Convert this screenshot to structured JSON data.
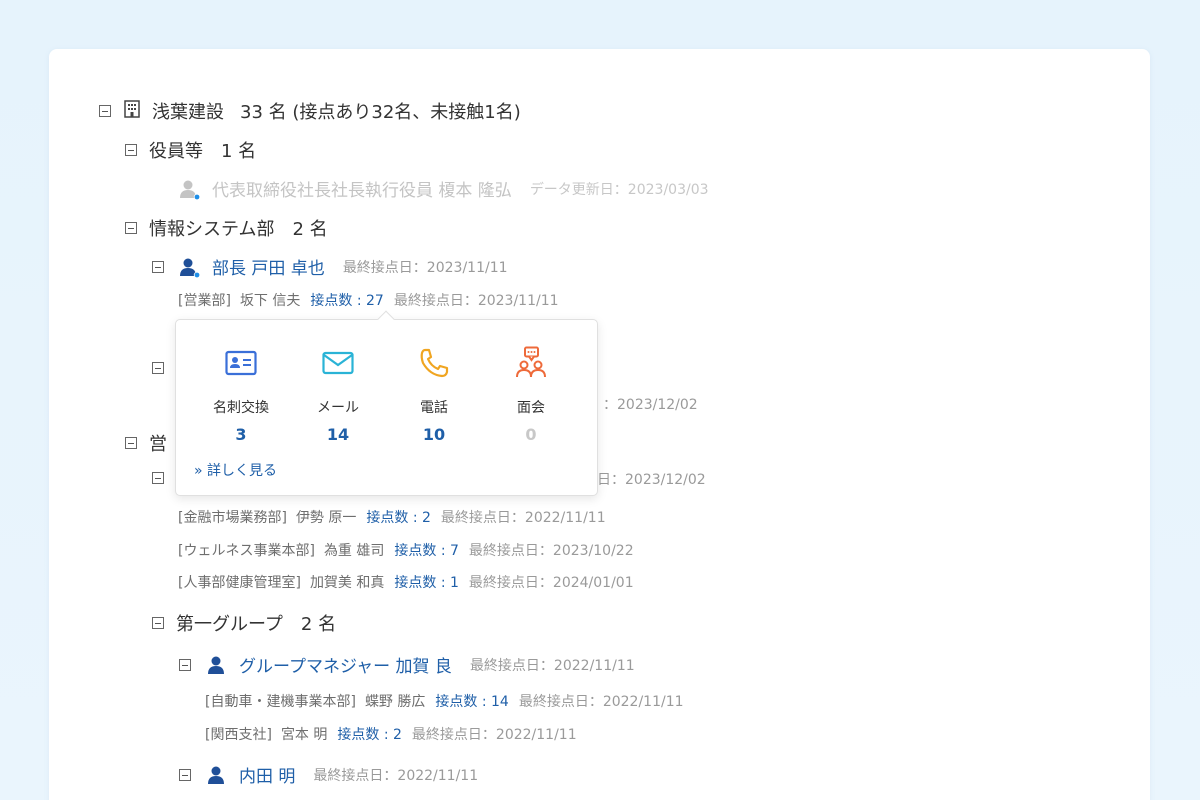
{
  "company": {
    "name": "浅葉建設",
    "count": "33 名 (接点あり32名、未接触1名)"
  },
  "executives": {
    "title": "役員等",
    "count": "1 名",
    "person": {
      "name": "代表取締役社長社長執行役員  榎本 隆弘",
      "meta": "データ更新日：2023/03/03"
    }
  },
  "infosys": {
    "title": "情報システム部",
    "count": "2 名",
    "manager": {
      "name": "部長  戸田 卓也",
      "meta": "最終接点日：2023/11/11"
    },
    "contact": {
      "dept": "[営業部]",
      "name": "坂下 信夫",
      "count": "接点数 : 27",
      "meta": "最終接点日：2023/11/11"
    },
    "hidden_date": "：2023/12/02"
  },
  "sales": {
    "title_partial": "営",
    "hidden_date": "日：2023/12/02",
    "contacts": [
      {
        "dept": "[金融市場業務部]",
        "name": "伊勢 原一",
        "count": "接点数 : 2",
        "meta": "最終接点日：2022/11/11"
      },
      {
        "dept": "[ウェルネス事業本部]",
        "name": "為重 雄司",
        "count": "接点数 : 7",
        "meta": "最終接点日：2023/10/22"
      },
      {
        "dept": "[人事部健康管理室]",
        "name": "加賀美 和真",
        "count": "接点数 : 1",
        "meta": "最終接点日：2024/01/01"
      }
    ]
  },
  "group1": {
    "title": "第一グループ",
    "count": "2 名",
    "manager": {
      "name": "グループマネジャー  加賀 良",
      "meta": "最終接点日：2022/11/11"
    },
    "contacts": [
      {
        "dept": "[自動車・建機事業本部]",
        "name": "蝶野 勝広",
        "count": "接点数 : 14",
        "meta": "最終接点日：2022/11/11"
      },
      {
        "dept": "[関西支社]",
        "name": "宮本 明",
        "count": "接点数 : 2",
        "meta": "最終接点日：2022/11/11"
      }
    ],
    "member": {
      "name": "内田 明",
      "meta": "最終接点日：2022/11/11"
    }
  },
  "popup": {
    "stats": [
      {
        "label": "名刺交換",
        "value": "3",
        "icon": "business-card-icon",
        "color": "#3a6fd8"
      },
      {
        "label": "メール",
        "value": "14",
        "icon": "mail-icon",
        "color": "#2ab3d6"
      },
      {
        "label": "電話",
        "value": "10",
        "icon": "phone-icon",
        "color": "#f0a521"
      },
      {
        "label": "面会",
        "value": "0",
        "icon": "meeting-icon",
        "color": "#ee6a3a"
      }
    ],
    "more_label": "» 詳しく見る"
  },
  "colors": {
    "link": "#1f5fa8",
    "background": "#e8f4fc",
    "status_dot": "#1f8fe8"
  }
}
